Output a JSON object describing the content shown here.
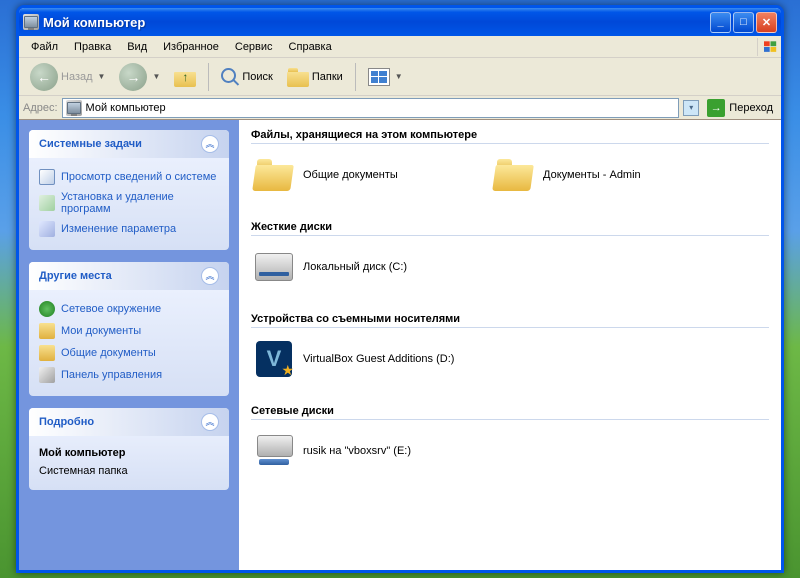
{
  "window": {
    "title": "Мой компьютер"
  },
  "menu": {
    "file": "Файл",
    "edit": "Правка",
    "view": "Вид",
    "favorites": "Избранное",
    "tools": "Сервис",
    "help": "Справка"
  },
  "toolbar": {
    "back": "Назад",
    "search": "Поиск",
    "folders": "Папки"
  },
  "addressbar": {
    "label": "Адрес:",
    "value": "Мой компьютер",
    "go": "Переход"
  },
  "sidebar": {
    "system_tasks": {
      "title": "Системные задачи",
      "items": {
        "sysinfo": "Просмотр сведений о системе",
        "addremove": "Установка и удаление программ",
        "settings": "Изменение параметра"
      }
    },
    "other_places": {
      "title": "Другие места",
      "items": {
        "network": "Сетевое окружение",
        "mydocs": "Мои документы",
        "shareddocs": "Общие документы",
        "cpanel": "Панель управления"
      }
    },
    "details": {
      "title": "Подробно",
      "name": "Мой компьютер",
      "type": "Системная папка"
    }
  },
  "main": {
    "sections": {
      "files": {
        "title": "Файлы, хранящиеся на этом компьютере",
        "shared": "Общие документы",
        "userdocs": "Документы - Admin"
      },
      "hdd": {
        "title": "Жесткие диски",
        "local": "Локальный диск (C:)"
      },
      "removable": {
        "title": "Устройства со съемными носителями",
        "vbox": "VirtualBox Guest Additions (D:)"
      },
      "network": {
        "title": "Сетевые диски",
        "share": "rusik на \"vboxsrv\" (E:)"
      }
    }
  }
}
